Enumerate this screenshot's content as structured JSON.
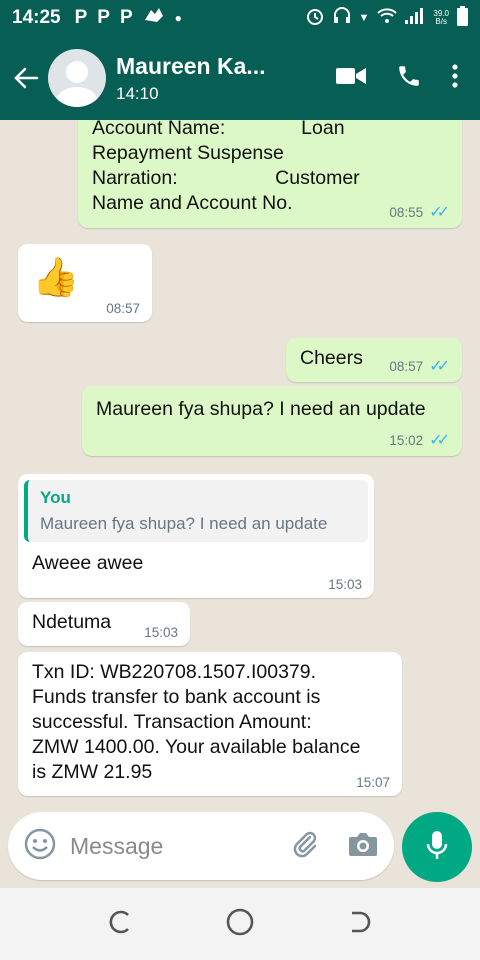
{
  "status_bar": {
    "time": "14:25",
    "notif_icons": [
      "P",
      "P",
      "P"
    ],
    "network_speed_top": "39.0",
    "network_speed_bottom": "B/s"
  },
  "header": {
    "contact_name": "Maureen Ka...",
    "subtitle": "14:10",
    "icons": [
      "back-arrow-icon",
      "avatar",
      "video-call-icon",
      "phone-icon",
      "more-vert-icon"
    ]
  },
  "messages": [
    {
      "id": "m1",
      "direction": "out",
      "lines": [
        "Account Name:              Loan",
        "Repayment Suspense",
        "Narration:                  Customer",
        "Name and Account No."
      ],
      "time": "08:55",
      "read": true
    },
    {
      "id": "m2",
      "direction": "in",
      "emoji": "👍",
      "time": "08:57"
    },
    {
      "id": "m3",
      "direction": "out",
      "text": "Cheers",
      "time": "08:57",
      "read": true
    },
    {
      "id": "m4",
      "direction": "out",
      "text": "Maureen fya shupa? I need an update",
      "time": "15:02",
      "read": true
    },
    {
      "id": "m5",
      "direction": "in",
      "quote_author": "You",
      "quote_text": "Maureen fya shupa? I need an update",
      "text": "Aweee awee",
      "time": "15:03"
    },
    {
      "id": "m6",
      "direction": "in",
      "text": "Ndetuma",
      "time": "15:03"
    },
    {
      "id": "m7",
      "direction": "in",
      "lines": [
        "Txn ID: WB220708.1507.I00379.",
        "Funds transfer to bank account is",
        "successful. Transaction Amount:",
        "ZMW 1400.00. Your available balance",
        "is ZMW 21.95"
      ],
      "time": "15:07"
    }
  ],
  "input": {
    "placeholder": "Message"
  },
  "colors": {
    "header": "#075e54",
    "outgoing_bubble": "#dcf8c6",
    "incoming_bubble": "#ffffff",
    "accent": "#00a884",
    "read_ticks": "#34b7f1",
    "chat_bg": "#e9e3da"
  }
}
